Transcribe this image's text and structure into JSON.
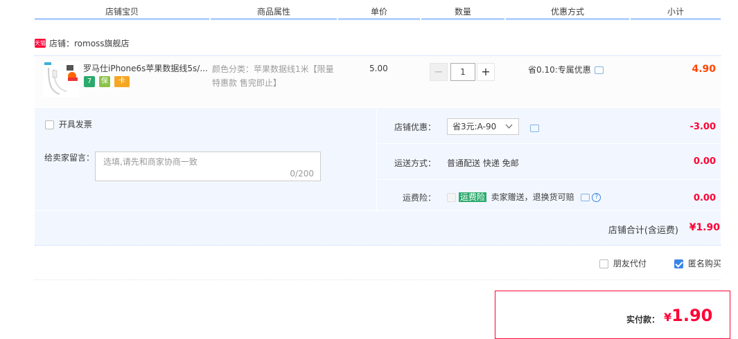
{
  "header": {
    "columns": [
      "店铺宝贝",
      "商品属性",
      "单价",
      "数量",
      "优惠方式",
      "小计"
    ]
  },
  "shop": {
    "badge": "天猫",
    "label": "店铺：romoss旗舰店"
  },
  "item": {
    "title": "罗马仕iPhone6s苹果数据线5s/...",
    "sku_line1": "颜色分类：苹果数据线1米【限量",
    "sku_line2": "特惠款 售完即止】",
    "price": "5.00",
    "quantity_minus": "−",
    "quantity": "1",
    "quantity_plus": "+",
    "discount": "省0.10:专属优惠",
    "subtotal": "4.90",
    "promo_icons": [
      "7",
      "保",
      "卡"
    ],
    "colors": {
      "accent_red": "#ff0036",
      "blue": "#3a85e6",
      "green": "#2ca96d"
    }
  },
  "invoice": {
    "label": "开具发票"
  },
  "message": {
    "label": "给卖家留言：",
    "placeholder": "选填,请先和商家协商一致",
    "counter": "0/200"
  },
  "shop_coupon": {
    "label": "店铺优惠：",
    "selected": "省3元:A-90",
    "amount": "-3.00"
  },
  "shipping": {
    "label": "运送方式：",
    "value": "普通配送 快递 免邮",
    "amount": "0.00"
  },
  "insurance": {
    "label": "运费险：",
    "tag": "运费险",
    "value": "卖家赠送，退换货可赔",
    "amount": "0.00"
  },
  "shop_total": {
    "label": "店铺合计(含运费)",
    "value": "¥1.90"
  },
  "options": {
    "friend_pay": "朋友代付",
    "anonymous": "匿名购买",
    "anonymous_checked": true
  },
  "payment": {
    "label": "实付款：",
    "value": "1.90",
    "currency": "¥"
  }
}
